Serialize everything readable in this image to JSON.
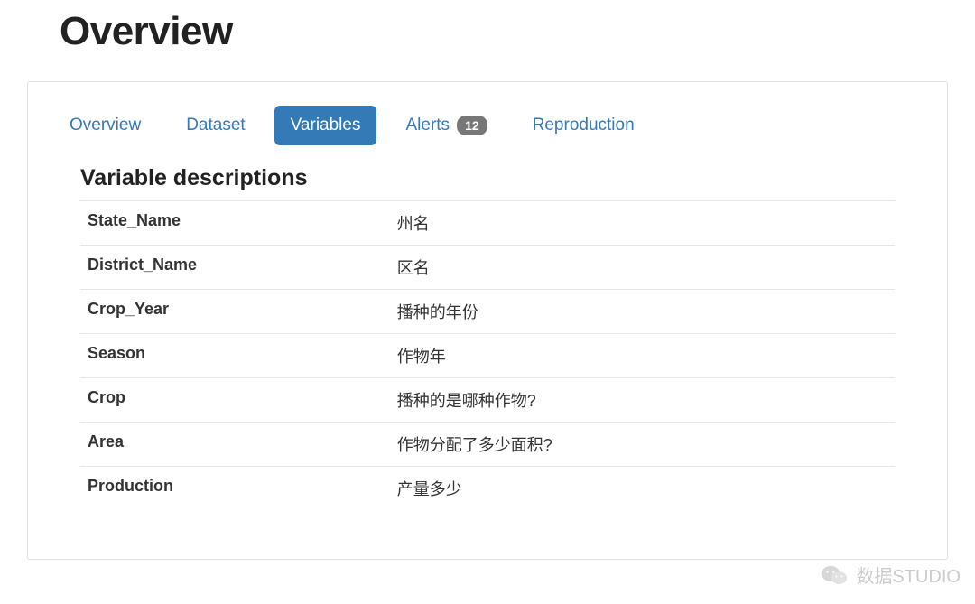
{
  "header": {
    "title": "Overview"
  },
  "tabs": [
    {
      "id": "overview",
      "label": "Overview",
      "active": false,
      "badge": null
    },
    {
      "id": "dataset",
      "label": "Dataset",
      "active": false,
      "badge": null
    },
    {
      "id": "variables",
      "label": "Variables",
      "active": true,
      "badge": null
    },
    {
      "id": "alerts",
      "label": "Alerts",
      "active": false,
      "badge": "12"
    },
    {
      "id": "reproduction",
      "label": "Reproduction",
      "active": false,
      "badge": null
    }
  ],
  "section": {
    "title": "Variable descriptions",
    "rows": [
      {
        "name": "State_Name",
        "description": "州名"
      },
      {
        "name": "District_Name",
        "description": "区名"
      },
      {
        "name": "Crop_Year",
        "description": "播种的年份"
      },
      {
        "name": "Season",
        "description": "作物年"
      },
      {
        "name": "Crop",
        "description": "播种的是哪种作物?"
      },
      {
        "name": "Area",
        "description": "作物分配了多少面积?"
      },
      {
        "name": "Production",
        "description": "产量多少"
      }
    ]
  },
  "watermark": {
    "icon": "wechat-icon",
    "text": "数据STUDIO"
  }
}
